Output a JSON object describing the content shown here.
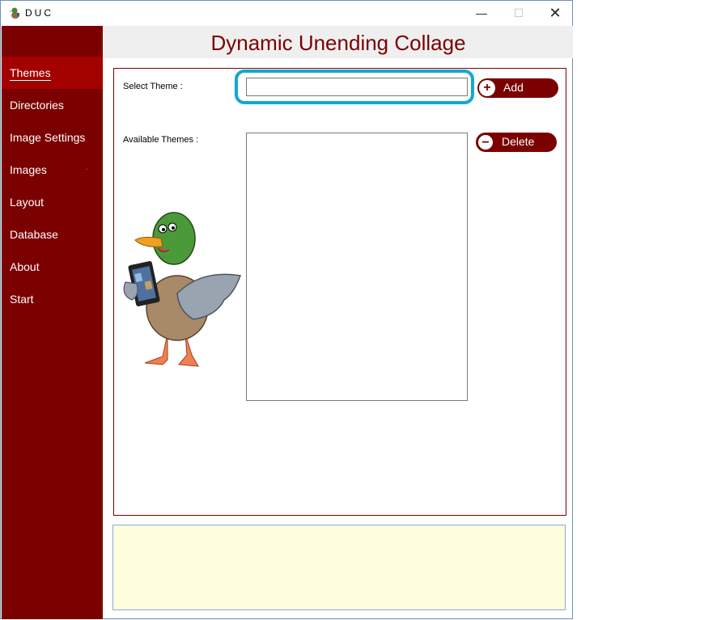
{
  "window": {
    "title": "DUC",
    "controls": {
      "minimize": "—",
      "maximize": "☐",
      "close": "✕"
    }
  },
  "header": {
    "title": "Dynamic Unending Collage"
  },
  "sidebar": {
    "items": [
      {
        "label": "Themes",
        "active": true
      },
      {
        "label": "Directories"
      },
      {
        "label": "Image Settings"
      },
      {
        "label": "Images"
      },
      {
        "label": "Layout"
      },
      {
        "label": "Database"
      },
      {
        "label": "About"
      },
      {
        "label": "Start"
      }
    ]
  },
  "themes_panel": {
    "select_label": "Select Theme :",
    "select_value": "",
    "available_label": "Available Themes :",
    "available_themes": [],
    "add_label": "Add",
    "delete_label": "Delete"
  },
  "status_box": {
    "text": ""
  },
  "colors": {
    "sidebar_bg": "#7b0000",
    "sidebar_active": "#a30000",
    "accent": "#7b0000",
    "focus_ring": "#14a8cf",
    "status_bg": "#ffffde"
  },
  "icons": {
    "app": "duck-app-icon",
    "add": "plus-circle-icon",
    "delete": "minus-circle-icon",
    "illustration": "duck-with-phone-illustration"
  }
}
